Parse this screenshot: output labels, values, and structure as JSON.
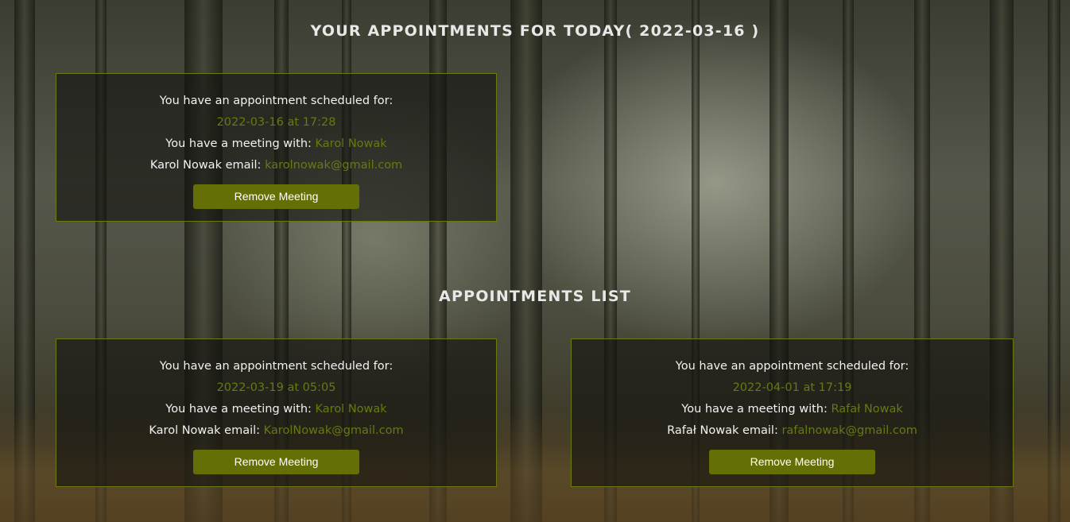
{
  "header": {
    "today_title": "YOUR APPOINTMENTS FOR TODAY( 2022-03-16 )",
    "list_title": "APPOINTMENTS LIST"
  },
  "today": [
    {
      "scheduled_label": "You have an appointment scheduled for:",
      "datetime": "2022-03-16 at 17:28",
      "meeting_label": "You have a meeting with:",
      "person": "Karol Nowak",
      "email_label": "Karol Nowak email:",
      "email": "karolnowak@gmail.com",
      "remove_label": "Remove Meeting"
    }
  ],
  "list": [
    {
      "scheduled_label": "You have an appointment scheduled for:",
      "datetime": "2022-03-19 at 05:05",
      "meeting_label": "You have a meeting with:",
      "person": "Karol Nowak",
      "email_label": "Karol Nowak email:",
      "email": "KarolNowak@gmail.com",
      "remove_label": "Remove Meeting"
    },
    {
      "scheduled_label": "You have an appointment scheduled for:",
      "datetime": "2022-04-01 at 17:19",
      "meeting_label": "You have a meeting with:",
      "person": "Rafał Nowak",
      "email_label": "Rafał Nowak email:",
      "email": "rafalnowak@gmail.com",
      "remove_label": "Remove Meeting"
    }
  ],
  "colors": {
    "accent": "#657a12",
    "button_bg": "#647006",
    "card_border": "#6b7a10",
    "heading": "#e8e8e8"
  }
}
